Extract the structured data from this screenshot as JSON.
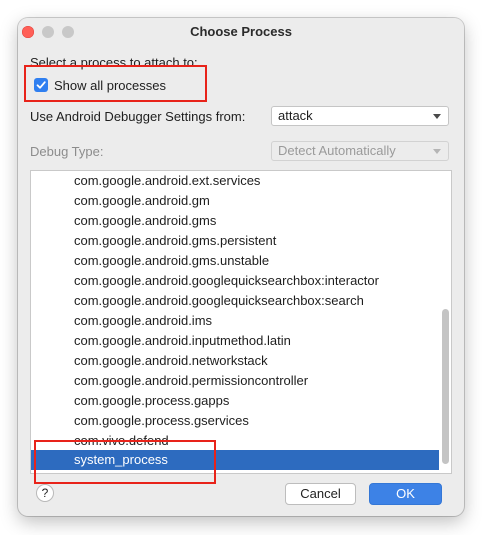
{
  "window": {
    "title": "Choose Process"
  },
  "prompt_label": "Select a process to attach to:",
  "show_all": {
    "label": "Show all processes",
    "checked": true
  },
  "debugger_settings": {
    "label": "Use Android Debugger Settings from:",
    "value": "attack"
  },
  "debug_type": {
    "label": "Debug Type:",
    "value": "Detect Automatically",
    "disabled": true
  },
  "process_list": {
    "items": [
      "com.google.android.ext.services",
      "com.google.android.gm",
      "com.google.android.gms",
      "com.google.android.gms.persistent",
      "com.google.android.gms.unstable",
      "com.google.android.googlequicksearchbox:interactor",
      "com.google.android.googlequicksearchbox:search",
      "com.google.android.ims",
      "com.google.android.inputmethod.latin",
      "com.google.android.networkstack",
      "com.google.android.permissioncontroller",
      "com.google.process.gapps",
      "com.google.process.gservices",
      "com.vivo.defend",
      "system_process"
    ],
    "selected": "system_process"
  },
  "buttons": {
    "help": "?",
    "cancel": "Cancel",
    "ok": "OK"
  },
  "colors": {
    "accent": "#2f7ff0",
    "selection": "#2d6bbf",
    "annotation": "#e8231a",
    "close": "#ff5f57"
  }
}
